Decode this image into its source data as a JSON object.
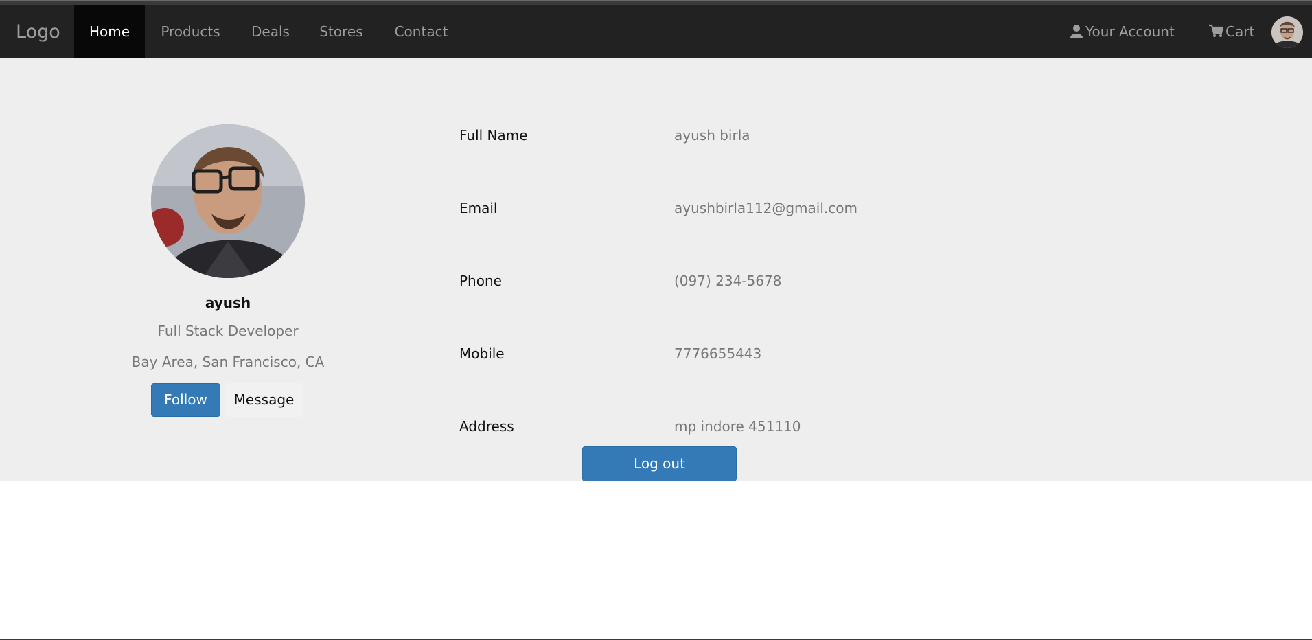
{
  "navbar": {
    "brand": "Logo",
    "items": [
      {
        "label": "Home",
        "active": true
      },
      {
        "label": "Products"
      },
      {
        "label": "Deals"
      },
      {
        "label": "Stores"
      },
      {
        "label": "Contact"
      }
    ],
    "account_label": "Your Account",
    "account_icon": "user-icon",
    "cart_label": "Cart",
    "cart_icon": "shopping-cart-icon"
  },
  "profile": {
    "name": "ayush",
    "title": "Full Stack Developer",
    "location": "Bay Area, San Francisco, CA",
    "follow_label": "Follow",
    "message_label": "Message"
  },
  "details": [
    {
      "label": "Full Name",
      "value": "ayush birla"
    },
    {
      "label": "Email",
      "value": "ayushbirla112@gmail.com"
    },
    {
      "label": "Phone",
      "value": "(097) 234-5678"
    },
    {
      "label": "Mobile",
      "value": "7776655443"
    },
    {
      "label": "Address",
      "value": "mp indore 451110"
    }
  ],
  "logout_label": "Log out",
  "colors": {
    "navbar_bg": "#222222",
    "content_bg": "#eeeeee",
    "primary": "#337ab7"
  }
}
